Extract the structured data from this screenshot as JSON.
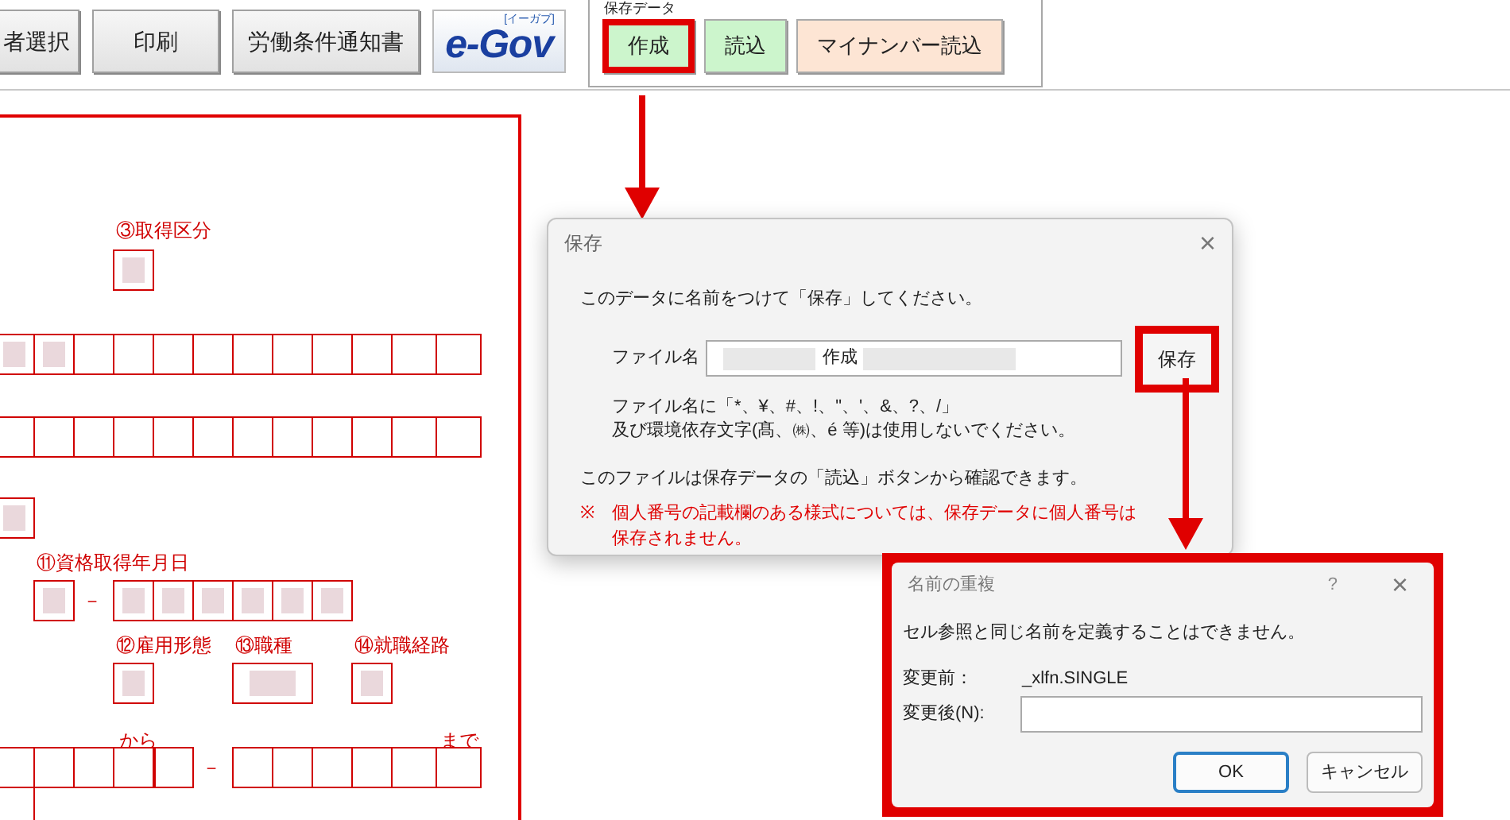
{
  "toolbar": {
    "buttons": [
      {
        "label": "者選択"
      },
      {
        "label": "印刷"
      },
      {
        "label": "労働条件通知書"
      }
    ],
    "logo": {
      "text": "e-Gov",
      "ruby": "[イーガブ]"
    },
    "save_data": {
      "title": "保存データ",
      "buttons": [
        {
          "label": "作成",
          "kind": "green",
          "highlighted": true
        },
        {
          "label": "読込",
          "kind": "green",
          "highlighted": false
        },
        {
          "label": "マイナンバー読込",
          "kind": "peach",
          "highlighted": false
        }
      ]
    }
  },
  "form": {
    "labels": [
      "③取得区分",
      "⑪資格取得年月日",
      "⑫雇用形態",
      "⑬職種",
      "⑭就職経路",
      "から",
      "まで"
    ],
    "separators": [
      "－",
      "－"
    ],
    "cell_groups": [
      {
        "cells": [
          {
            "filled": true
          }
        ]
      },
      {
        "cells": [
          {
            "filled": true
          },
          {
            "filled": true
          },
          {
            "filled": false
          },
          {
            "filled": false
          },
          {
            "filled": false
          },
          {
            "filled": false
          },
          {
            "filled": false
          },
          {
            "filled": false
          },
          {
            "filled": false
          },
          {
            "filled": false
          },
          {
            "filled": false
          },
          {
            "filled": false
          }
        ]
      },
      {
        "cells": [
          {
            "filled": false
          },
          {
            "filled": false
          },
          {
            "filled": false
          },
          {
            "filled": false
          },
          {
            "filled": false
          },
          {
            "filled": false
          },
          {
            "filled": false
          },
          {
            "filled": false
          },
          {
            "filled": false
          },
          {
            "filled": false
          },
          {
            "filled": false
          },
          {
            "filled": false
          }
        ]
      },
      {
        "cells": [
          {
            "filled": true
          }
        ]
      },
      {
        "cells": [
          {
            "filled": true
          }
        ]
      },
      {
        "cells": [
          {
            "filled": true
          },
          {
            "filled": true
          },
          {
            "filled": true
          },
          {
            "filled": true
          },
          {
            "filled": true
          },
          {
            "filled": true
          }
        ]
      },
      {
        "cells": [
          {
            "filled": true
          }
        ]
      },
      {
        "cells": [
          {
            "filled": true
          }
        ]
      },
      {
        "cells": [
          {
            "filled": true
          }
        ]
      },
      {
        "cells": [
          {
            "filled": false
          },
          {
            "filled": false
          },
          {
            "filled": false
          },
          {
            "filled": false
          },
          {
            "filled": false
          }
        ]
      },
      {
        "cells": [
          {
            "filled": false
          },
          {
            "filled": false
          },
          {
            "filled": false
          },
          {
            "filled": false
          },
          {
            "filled": false
          },
          {
            "filled": false
          }
        ]
      }
    ]
  },
  "save_dialog": {
    "title": "保存",
    "close": "×",
    "instruction": "このデータに名前をつけて「保存」してください。",
    "file_name_label": "ファイル名",
    "file_name_value": "作成",
    "save_button": {
      "label": "保存",
      "highlighted": true
    },
    "hint_lines": [
      "ファイル名に「*、¥、#、!、\"、'、&、?、/」",
      "及び環境依存文字(髙、㈱、é 等)は使用しないでください。"
    ],
    "info": "このファイルは保存データの「読込」ボタンから確認できます。",
    "note_mark": "※",
    "note": "個人番号の記載欄のある様式については、保存データに個人番号は保存されません。"
  },
  "name_conflict_dialog": {
    "title": "名前の重複",
    "help": "?",
    "close": "×",
    "highlighted": true,
    "message": "セル参照と同じ名前を定義することはできません。",
    "before_label": "変更前：",
    "before_value": "_xlfn.SINGLE",
    "after_label": "変更後(N):",
    "buttons": [
      {
        "label": "OK",
        "kind": "default"
      },
      {
        "label": "キャンセル",
        "kind": "normal"
      }
    ]
  }
}
